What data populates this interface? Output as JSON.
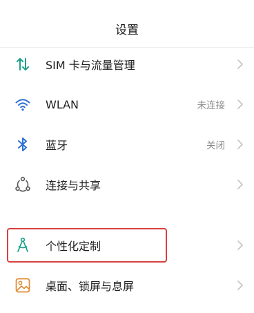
{
  "header": {
    "title": "设置"
  },
  "settings": {
    "items": [
      {
        "label": "SIM 卡与流量管理",
        "status": "",
        "icon": "sim-data-icon"
      },
      {
        "label": "WLAN",
        "status": "未连接",
        "icon": "wifi-icon"
      },
      {
        "label": "蓝牙",
        "status": "关闭",
        "icon": "bluetooth-icon"
      },
      {
        "label": "连接与共享",
        "status": "",
        "icon": "connection-share-icon"
      },
      {
        "label": "个性化定制",
        "status": "",
        "icon": "personalization-icon"
      },
      {
        "label": "桌面、锁屏与息屏",
        "status": "",
        "icon": "desktop-lockscreen-icon"
      }
    ]
  },
  "colors": {
    "accent_green": "#1aa08a",
    "accent_blue": "#2c6fd6",
    "accent_orange": "#e08a2e",
    "highlight_red": "#d8413f"
  }
}
